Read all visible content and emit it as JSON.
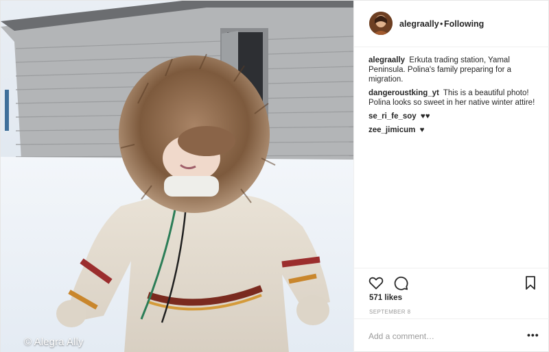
{
  "photo": {
    "watermark": "© Alegra Ally"
  },
  "header": {
    "username": "alegraally",
    "separator": "•",
    "follow_status": "Following"
  },
  "comments": [
    {
      "user": "alegraally",
      "text": "Erkuta trading station, Yamal Peninsula. Polina's family preparing for a migration."
    },
    {
      "user": "dangeroustking_yt",
      "text": "This is a beautiful photo! Polina looks so sweet in her native winter attire!"
    },
    {
      "user": "se_ri_fe_soy",
      "text": "♥♥"
    },
    {
      "user": "zee_jimicum",
      "text": "♥"
    }
  ],
  "actions": {
    "like_icon": "heart-icon",
    "comment_icon": "speech-bubble-icon",
    "save_icon": "bookmark-icon"
  },
  "likes": "571 likes",
  "date": "SEPTEMBER 8",
  "add_comment": {
    "placeholder": "Add a comment…"
  },
  "more_icon": "•••",
  "colors": {
    "text": "#262626",
    "muted": "#999999",
    "border": "#efefef"
  }
}
